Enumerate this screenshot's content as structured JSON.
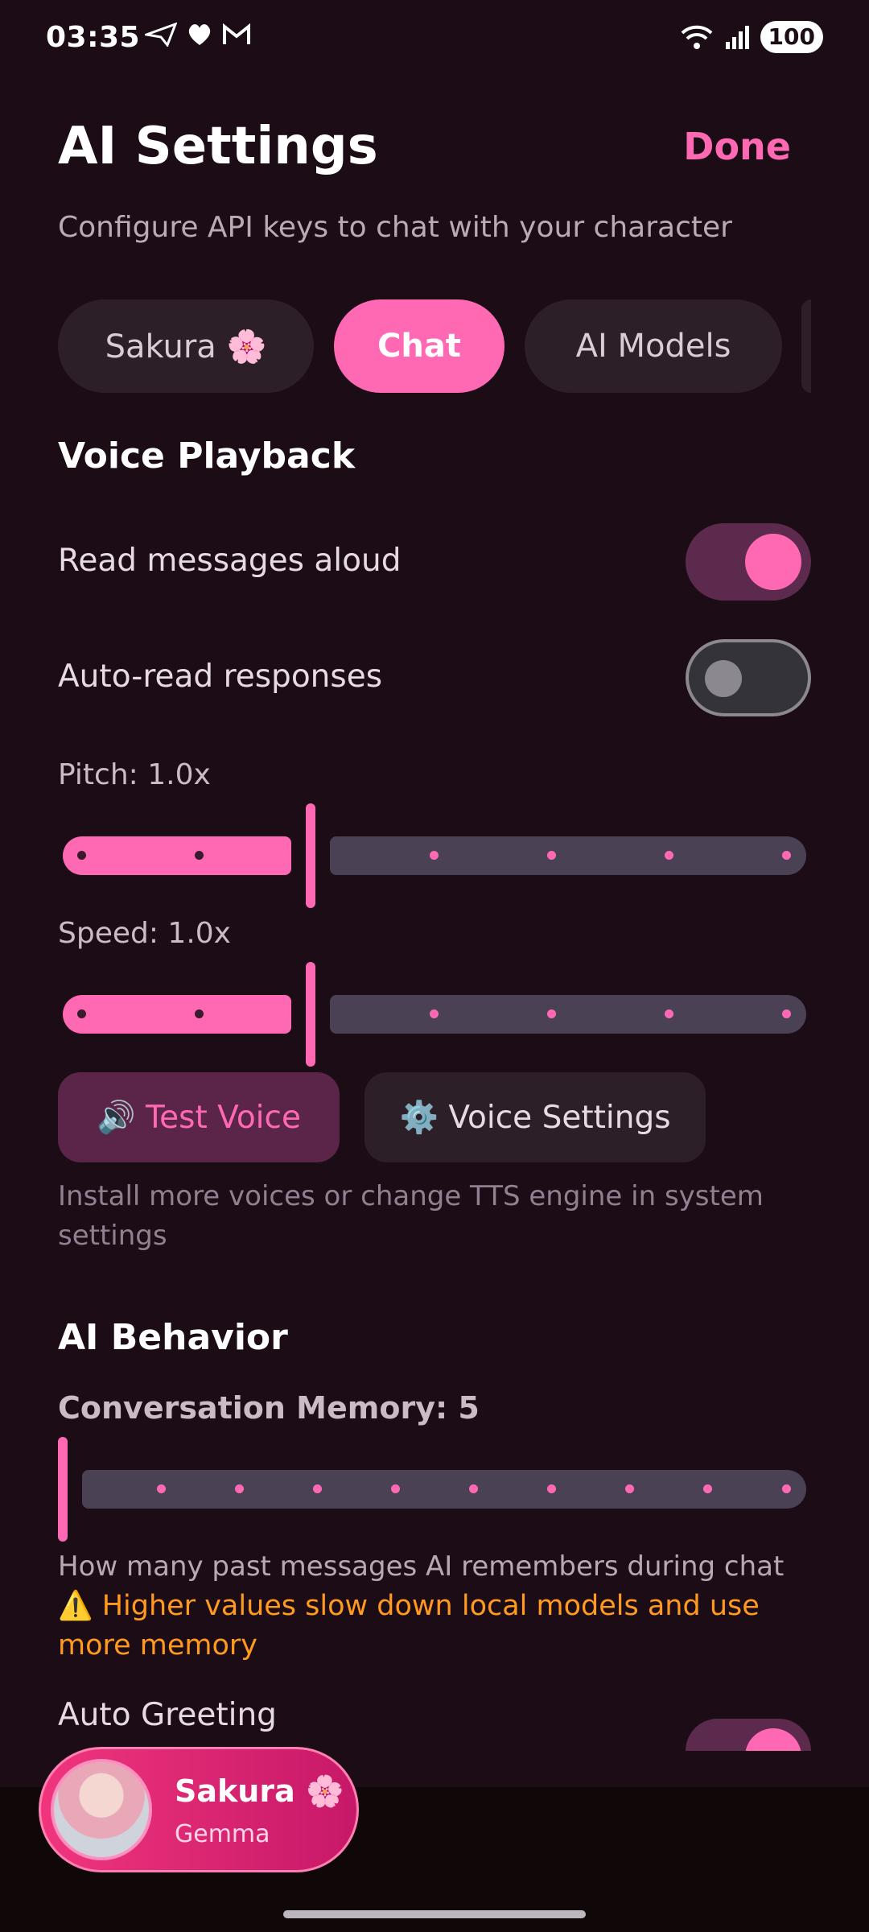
{
  "status_bar": {
    "time": "03:35",
    "battery": "100"
  },
  "header": {
    "title": "AI Settings",
    "done_label": "Done",
    "subtitle": "Configure API keys to chat with your character"
  },
  "tabs": [
    {
      "label": "Sakura 🌸"
    },
    {
      "label": "Chat",
      "active": true
    },
    {
      "label": "AI Models"
    }
  ],
  "voice_playback": {
    "title": "Voice Playback",
    "read_aloud_label": "Read messages aloud",
    "read_aloud_on": true,
    "auto_read_label": "Auto-read responses",
    "auto_read_on": false,
    "pitch_label": "Pitch: 1.0x",
    "pitch_value": 1.0,
    "speed_label": "Speed: 1.0x",
    "speed_value": 1.0,
    "test_voice_label": "🔊 Test Voice",
    "voice_settings_label": "⚙️ Voice Settings",
    "hint": "Install more voices or change TTS engine in system settings"
  },
  "ai_behavior": {
    "title": "AI Behavior",
    "memory_label": "Conversation Memory: 5",
    "memory_value": 5,
    "memory_hint": "How many past messages AI remembers during chat",
    "memory_warning": "⚠️ Higher values slow down local models and use more memory",
    "auto_greeting_label": "Auto Greeting"
  },
  "character_card": {
    "name": "Sakura 🌸",
    "model": "Gemma"
  },
  "colors": {
    "accent": "#ff69b4",
    "background": "#1b0c16",
    "warning": "#ff9a1f"
  }
}
